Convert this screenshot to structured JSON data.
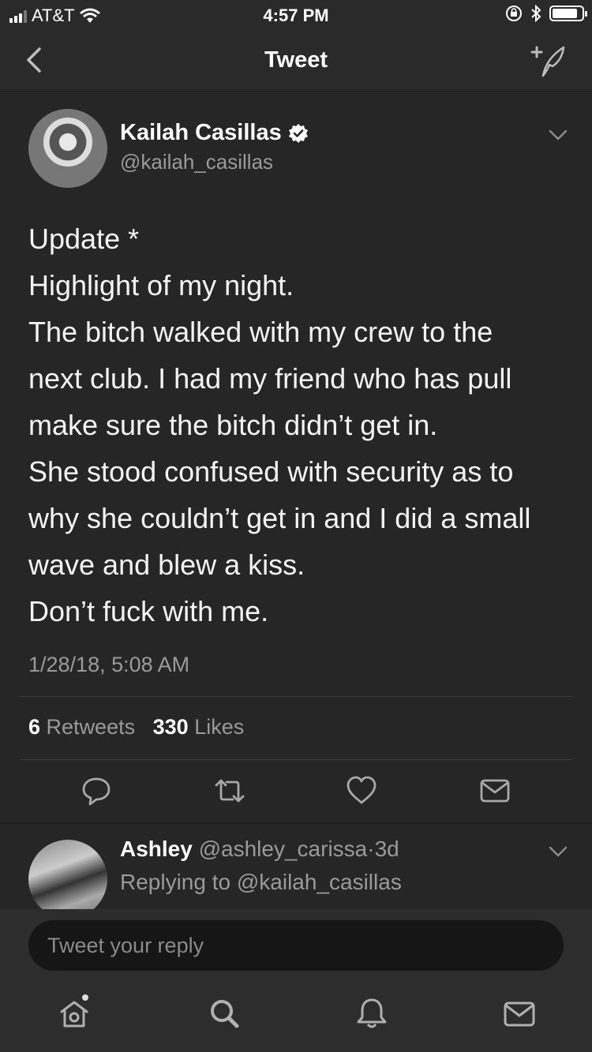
{
  "status_bar": {
    "carrier": "AT&T",
    "time": "4:57 PM",
    "battery_level": 0.85,
    "icons": [
      "signal-icon",
      "wifi-icon",
      "rotation-lock-icon",
      "bluetooth-icon",
      "battery-icon"
    ]
  },
  "nav": {
    "title": "Tweet",
    "back_icon": "back-chevron-icon",
    "compose_icon": "compose-tweet-icon"
  },
  "tweet": {
    "author_name": "Kailah Casillas",
    "verified": true,
    "author_handle": "@kailah_casillas",
    "text": "Update *\nHighlight of my night.\nThe bitch walked with my crew to the\nnext club. I had my friend who has pull\nmake sure the bitch didn’t get in.\nShe stood confused with security as to\nwhy she couldn’t get in and I did a small\nwave and blew a kiss.\nDon’t fuck with me.",
    "timestamp": "1/28/18, 5:08 AM",
    "retweets_count": "6",
    "retweets_label": "Retweets",
    "likes_count": "330",
    "likes_label": "Likes",
    "actions": [
      "reply-icon",
      "retweet-icon",
      "like-icon",
      "direct-message-icon"
    ]
  },
  "reply_preview": {
    "name": "Ashley",
    "handle": "@ashley_carissa",
    "separator": "·",
    "age": "3d",
    "replying_to": "Replying to @kailah_casillas"
  },
  "composer": {
    "placeholder": "Tweet your reply"
  },
  "tab_bar": {
    "tabs": [
      "home-icon",
      "search-icon",
      "notifications-icon",
      "messages-icon"
    ]
  },
  "colors": {
    "background": "#262626",
    "bars": "#2d2d2d",
    "secondary_text": "#9a9a9a",
    "primary_text": "#f4f4f4"
  }
}
